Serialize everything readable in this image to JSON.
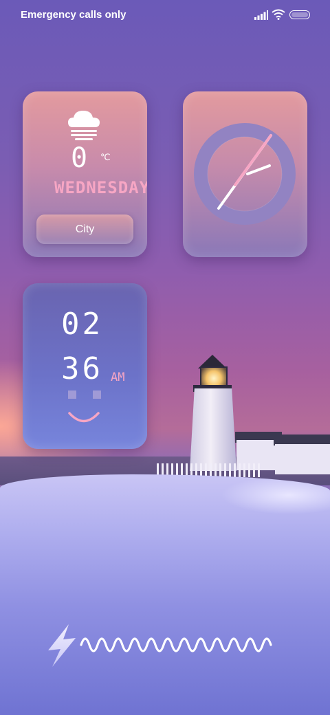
{
  "status_bar": {
    "carrier_text": "Emergency calls only",
    "icons": [
      "signal-icon",
      "wifi-icon",
      "battery-icon"
    ]
  },
  "weather_widget": {
    "icon": "cloud-icon",
    "temperature": "0",
    "unit": "℃",
    "weekday": "WEDNESDAY",
    "city_label": "City"
  },
  "clock_widget": {
    "icon": "analog-clock"
  },
  "time_widget": {
    "hours": "02",
    "minutes": "36",
    "period": "AM"
  },
  "bottom": {
    "icons": [
      "flash-icon",
      "wave-line"
    ]
  },
  "colors": {
    "accent_pink": "#f7a6c4",
    "widget_warm": "#e39a9e",
    "widget_cool": "#6a64b0"
  }
}
